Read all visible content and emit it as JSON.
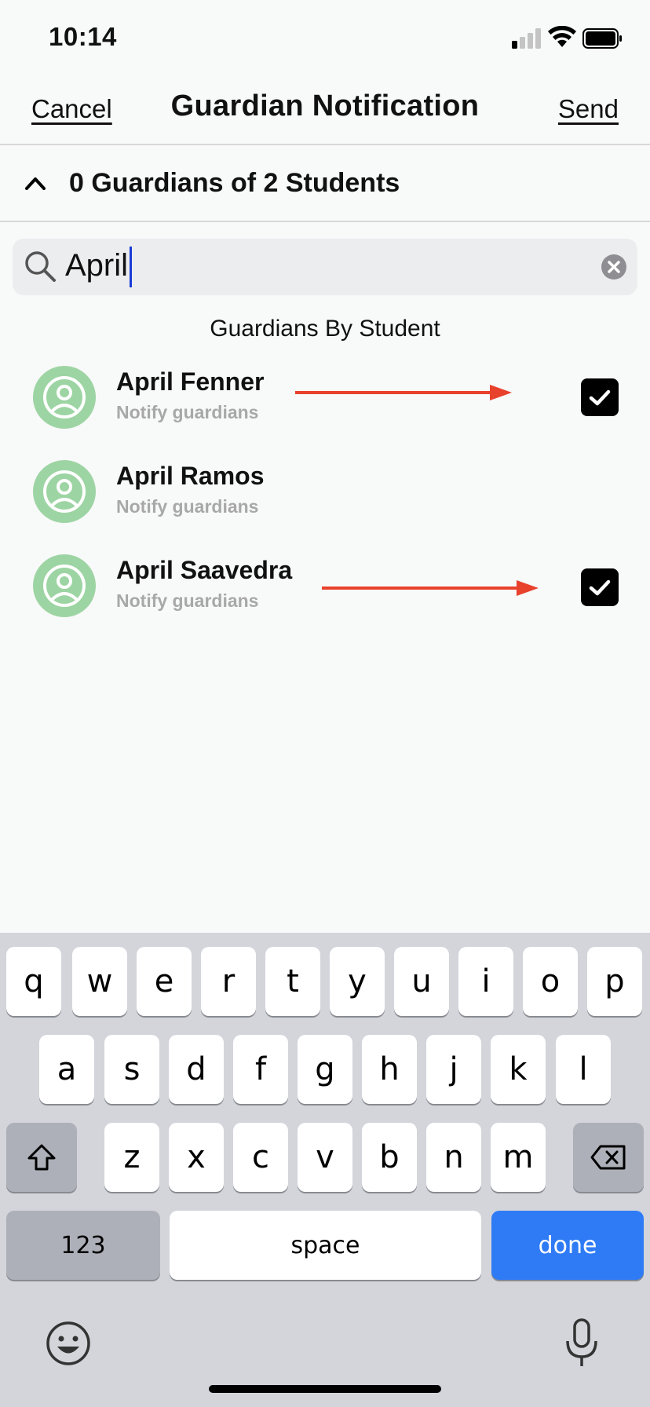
{
  "status_bar": {
    "time": "10:14"
  },
  "nav": {
    "cancel_label": "Cancel",
    "title": "Guardian Notification",
    "send_label": "Send"
  },
  "summary": {
    "text": "0 Guardians of 2 Students"
  },
  "search": {
    "value": "April"
  },
  "section_title": "Guardians By Student",
  "students": [
    {
      "name": "April Fenner",
      "subtitle": "Notify guardians",
      "checked": true
    },
    {
      "name": "April Ramos",
      "subtitle": "Notify guardians",
      "checked": false
    },
    {
      "name": "April Saavedra",
      "subtitle": "Notify guardians",
      "checked": true
    }
  ],
  "colors": {
    "avatar": "#9dd4a3",
    "annotation_arrow": "#e8412c",
    "done_key": "#2f7bf5"
  },
  "keyboard": {
    "row1": [
      "q",
      "w",
      "e",
      "r",
      "t",
      "y",
      "u",
      "i",
      "o",
      "p"
    ],
    "row2": [
      "a",
      "s",
      "d",
      "f",
      "g",
      "h",
      "j",
      "k",
      "l"
    ],
    "row3": [
      "z",
      "x",
      "c",
      "v",
      "b",
      "n",
      "m"
    ],
    "numbers_label": "123",
    "space_label": "space",
    "done_label": "done"
  }
}
